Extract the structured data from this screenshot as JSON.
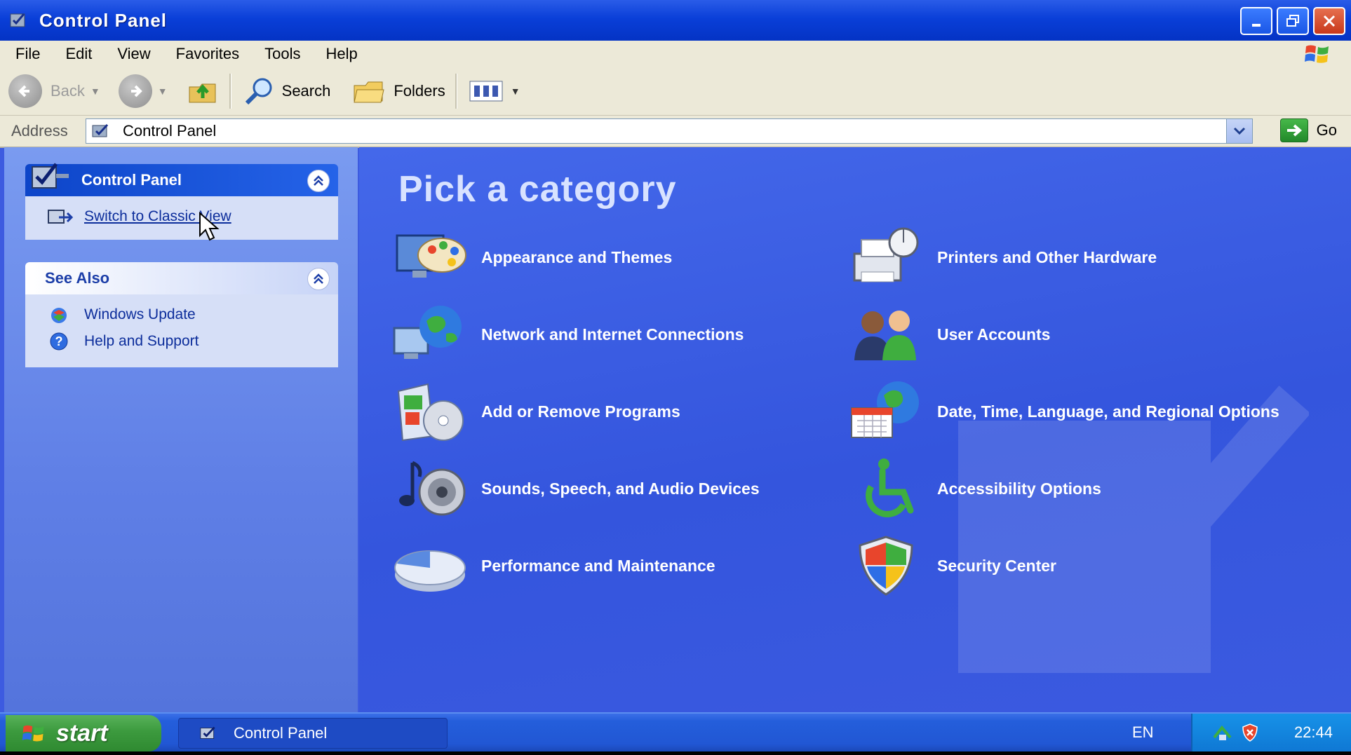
{
  "window": {
    "title": "Control Panel"
  },
  "menu": [
    "File",
    "Edit",
    "View",
    "Favorites",
    "Tools",
    "Help"
  ],
  "toolbar": {
    "back": "Back",
    "search": "Search",
    "folders": "Folders"
  },
  "address": {
    "label": "Address",
    "value": "Control Panel",
    "go": "Go"
  },
  "sidebar": {
    "panel1": {
      "title": "Control Panel",
      "link": "Switch to Classic View"
    },
    "panel2": {
      "title": "See Also",
      "links": [
        "Windows Update",
        "Help and Support"
      ]
    }
  },
  "main": {
    "heading": "Pick a category",
    "categories": [
      {
        "label": "Appearance and Themes",
        "icon": "appearance-themes-icon"
      },
      {
        "label": "Printers and Other Hardware",
        "icon": "printer-hardware-icon"
      },
      {
        "label": "Network and Internet Connections",
        "icon": "network-globe-icon"
      },
      {
        "label": "User Accounts",
        "icon": "user-accounts-icon"
      },
      {
        "label": "Add or Remove Programs",
        "icon": "add-remove-programs-icon"
      },
      {
        "label": "Date, Time, Language, and Regional Options",
        "icon": "date-time-globe-icon"
      },
      {
        "label": "Sounds, Speech, and Audio Devices",
        "icon": "speaker-music-icon"
      },
      {
        "label": "Accessibility Options",
        "icon": "accessibility-wheelchair-icon"
      },
      {
        "label": "Performance and Maintenance",
        "icon": "performance-pie-icon"
      },
      {
        "label": "Security Center",
        "icon": "security-shield-icon"
      }
    ]
  },
  "taskbar": {
    "start": "start",
    "task": "Control Panel",
    "language": "EN",
    "clock": "22:44"
  },
  "colors": {
    "title_bar": "#0a3fd8",
    "main_bg": "#3d5be0",
    "start_green": "#3c9a3e",
    "tray_blue": "#1792e8"
  }
}
